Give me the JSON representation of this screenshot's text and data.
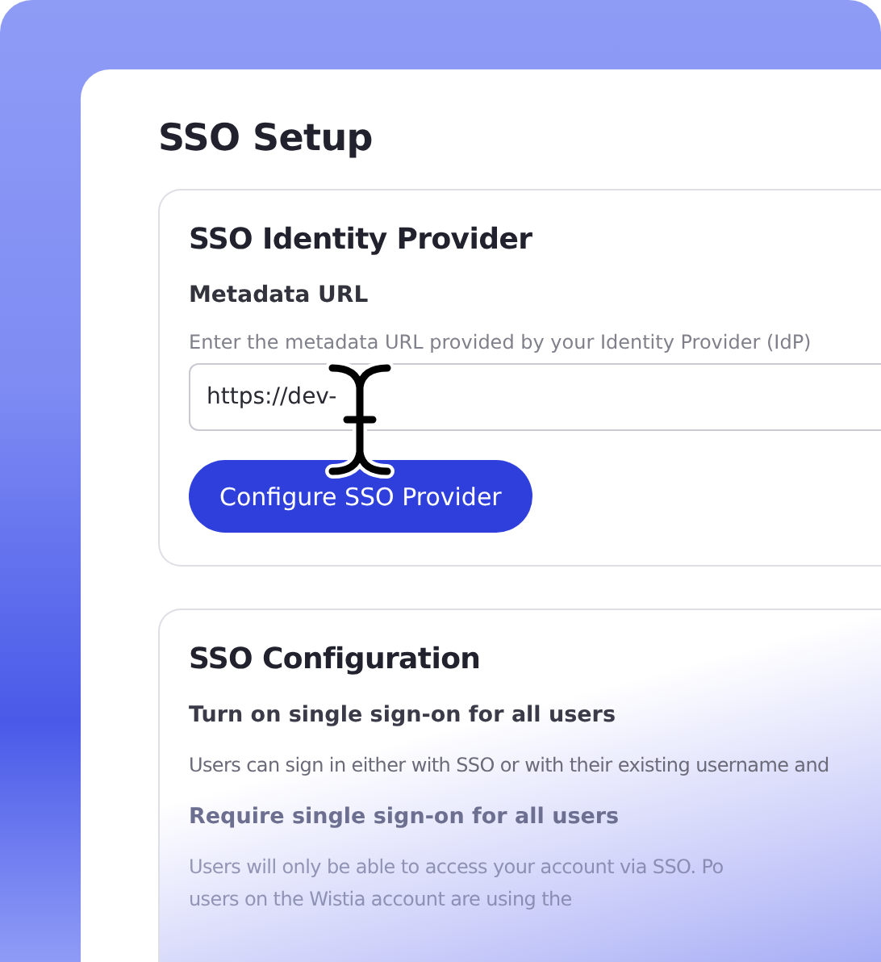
{
  "page": {
    "title": "SSO Setup"
  },
  "identity_provider": {
    "title": "SSO Identity Provider",
    "field_label": "Metadata URL",
    "hint": "Enter the metadata URL provided by your Identity Provider (IdP)",
    "value": "https://dev-",
    "button": "Configure SSO Provider"
  },
  "configuration": {
    "title": "SSO Configuration",
    "options": [
      {
        "title": "Turn on single sign-on for all users",
        "lines": [
          "Users can sign in either with SSO or with their existing username and"
        ]
      },
      {
        "title": "Require single sign-on for all users",
        "lines": [
          "Users will only be able to access your account via SSO. Po",
          "users on the Wistia account are using the"
        ]
      }
    ]
  }
}
